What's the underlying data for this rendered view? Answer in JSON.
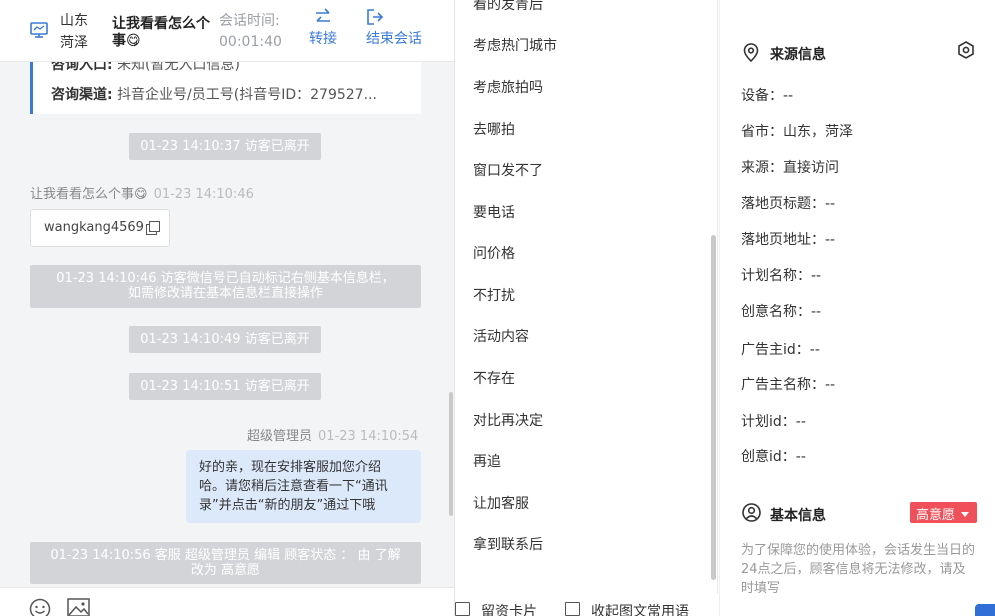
{
  "header": {
    "location_line1": "山东",
    "location_line2": "菏泽",
    "visitor_name": "让我看看怎么个事😋",
    "session_time_label": "会话时间:",
    "session_time": "00:01:40",
    "transfer_label": "转接",
    "end_label": "结束会话"
  },
  "info_card": {
    "entry_label": "咨询入口:",
    "entry_value": "未知(暂无入口信息)",
    "channel_label": "咨询渠道:",
    "channel_value": "抖音企业号/员工号(抖音号ID：279527..."
  },
  "messages": {
    "sys1": "01-23 14:10:37 访客已离开",
    "visitor_sender": "让我看看怎么个事😋",
    "visitor_time": "01-23 14:10:46",
    "wechat_value": "wangkang4569",
    "sys2_line1": "01-23 14:10:46 访客微信号已自动标记右侧基本信息栏，",
    "sys2_line2": "如需修改请在基本信息栏直接操作",
    "sys3": "01-23 14:10:49 访客已离开",
    "sys4": "01-23 14:10:51 访客已离开",
    "agent_sender": "超级管理员",
    "agent_time": "01-23 14:10:54",
    "agent_line1": "好的亲，现在安排客服加您介绍",
    "agent_line2": "哈。请您稍后注意查看一下“通讯",
    "agent_line3": "录”并点击“新的朋友”通过下哦",
    "sys5_line1": "01-23 14:10:56 客服 超级管理员 编辑 顾客状态 ： 由 了解",
    "sys5_line2": "改为 高意愿"
  },
  "quick_replies": [
    "看的发青后",
    "考虑热门城市",
    "考虑旅拍吗",
    "去哪拍",
    "窗口发不了",
    "要电话",
    "问价格",
    "不打扰",
    "活动内容",
    "不存在",
    "对比再决定",
    "再追",
    "让加客服",
    "拿到联系后"
  ],
  "quick_footer": {
    "card_label": "留资卡片",
    "phrases_label": "收起图文常用语"
  },
  "source_info": {
    "title": "来源信息",
    "fields": [
      {
        "label": "设备：",
        "value": "--"
      },
      {
        "label": "省市：",
        "value": "山东，菏泽"
      },
      {
        "label": "来源：",
        "value": "直接访问"
      },
      {
        "label": "落地页标题：",
        "value": "--"
      },
      {
        "label": "落地页地址：",
        "value": "--"
      },
      {
        "label": "计划名称：",
        "value": "--"
      },
      {
        "label": "创意名称：",
        "value": "--"
      },
      {
        "label": "广告主id：",
        "value": "--"
      },
      {
        "label": "广告主名称：",
        "value": "--"
      },
      {
        "label": "计划id：",
        "value": "--"
      },
      {
        "label": "创意id：",
        "value": "--"
      }
    ]
  },
  "basic_info": {
    "title": "基本信息",
    "intent_badge": "高意愿",
    "note": "为了保障您的使用体验，会话发生当日的24点之后，顾客信息将无法修改，请及时填写"
  },
  "colors": {
    "accent": "#3a7bd5",
    "badge": "#f0505a",
    "system_message_bg": "#d3d4d7",
    "agent_bubble_bg": "#dce9fb"
  }
}
